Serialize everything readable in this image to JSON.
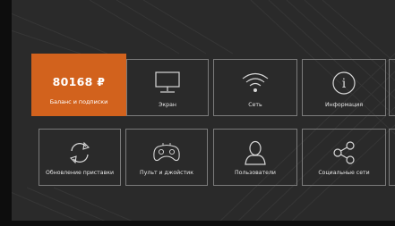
{
  "balance_tile": {
    "amount": "80168 ₽",
    "label": "Баланс и подписки"
  },
  "row1": [
    {
      "label": "Экран",
      "icon": "monitor-icon"
    },
    {
      "label": "Сеть",
      "icon": "wifi-icon"
    },
    {
      "label": "Информация",
      "icon": "info-icon"
    }
  ],
  "row2": [
    {
      "label": "Обновление приставки",
      "icon": "refresh-icon"
    },
    {
      "label": "Пульт и джойстик",
      "icon": "gamepad-icon"
    },
    {
      "label": "Пользователи",
      "icon": "user-icon"
    },
    {
      "label": "Социальные сети",
      "icon": "share-icon"
    }
  ],
  "colors": {
    "accent": "#d2621d",
    "tile_border": "#7b7b7b",
    "background": "#2a2a2a"
  }
}
